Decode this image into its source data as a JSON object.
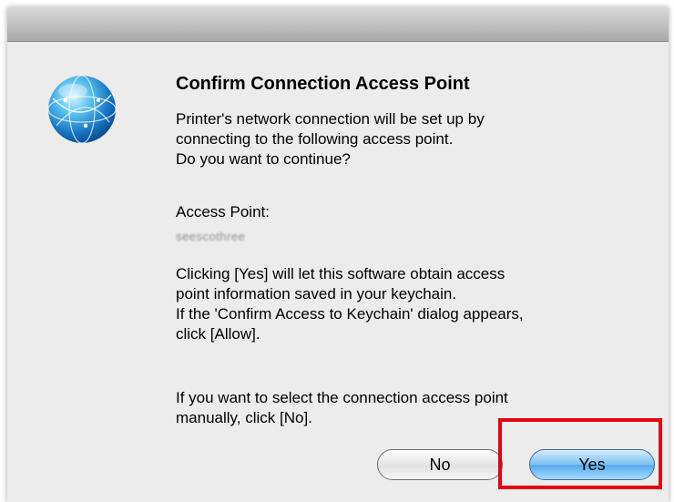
{
  "dialog": {
    "title": "Confirm Connection Access Point",
    "message_1": "Printer's network connection will be set up by\nconnecting to the following access point.\nDo you want to continue?",
    "access_point_label": "Access Point:",
    "access_point_value": "seescothree",
    "message_2": "Clicking [Yes] will let this software obtain access\npoint information saved in your keychain.\nIf the 'Confirm Access to Keychain' dialog appears,\nclick [Allow].",
    "message_3": "If you want to select the connection access point\nmanually, click [No].",
    "icon": "globe-icon"
  },
  "buttons": {
    "no_label": "No",
    "yes_label": "Yes"
  },
  "colors": {
    "highlight": "#e60012",
    "default_button": "#56a9ec"
  }
}
